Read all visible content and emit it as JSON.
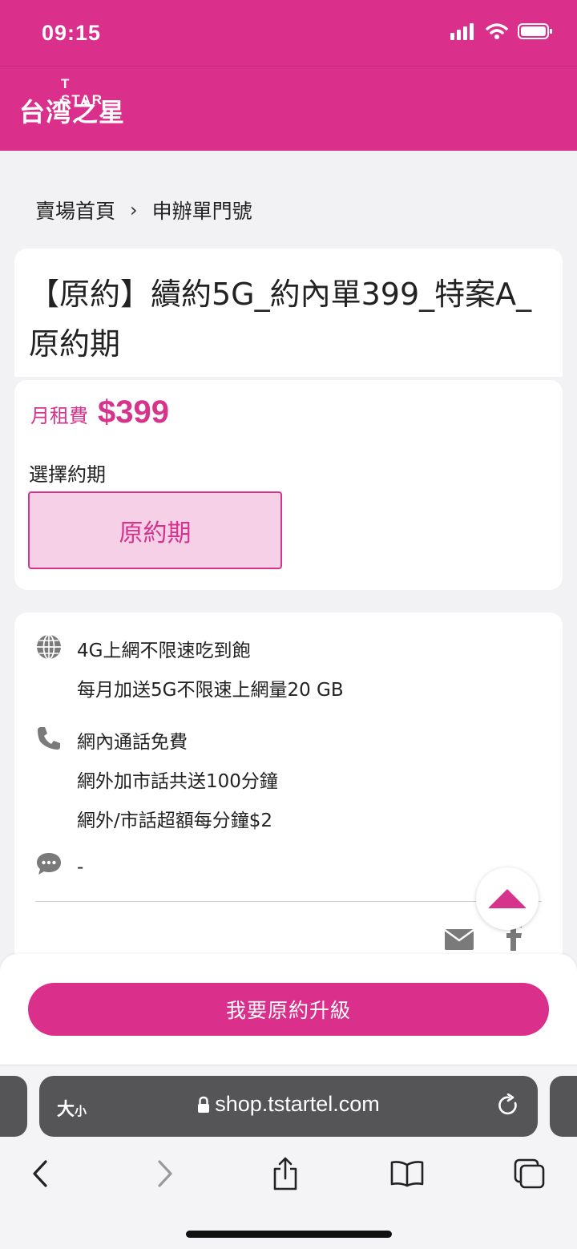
{
  "status_bar": {
    "time": "09:15",
    "icons": [
      "signal-icon",
      "wifi-icon",
      "battery-icon"
    ]
  },
  "header": {
    "logo_en": "T STAR",
    "logo_zh": "台湾之星",
    "brand_color": "#da2f8b"
  },
  "breadcrumb": {
    "home": "賣場首頁",
    "separator": "›",
    "current": "申辦單門號"
  },
  "plan": {
    "title": "【原約】續約5G_約內單399_特案A_原約期",
    "price_label": "月租費",
    "price": "$399",
    "period_label": "選擇約期",
    "period_option": "原約期"
  },
  "features": {
    "data": {
      "icon": "globe-icon",
      "lines": [
        "4G上網不限速吃到飽",
        "每月加送5G不限速上網量20 GB"
      ]
    },
    "voice": {
      "icon": "phone-icon",
      "lines": [
        "網內通話免費",
        "網外加市話共送100分鐘",
        "網外/市話超額每分鐘$2"
      ]
    },
    "sms": {
      "icon": "chat-icon",
      "lines": [
        "-"
      ]
    }
  },
  "share_icons": [
    "mail-icon",
    "facebook-icon"
  ],
  "cta": {
    "label": "我要原約升級"
  },
  "browser": {
    "text_size_label": "大",
    "text_size_small": "小",
    "url": "shop.tstartel.com"
  }
}
